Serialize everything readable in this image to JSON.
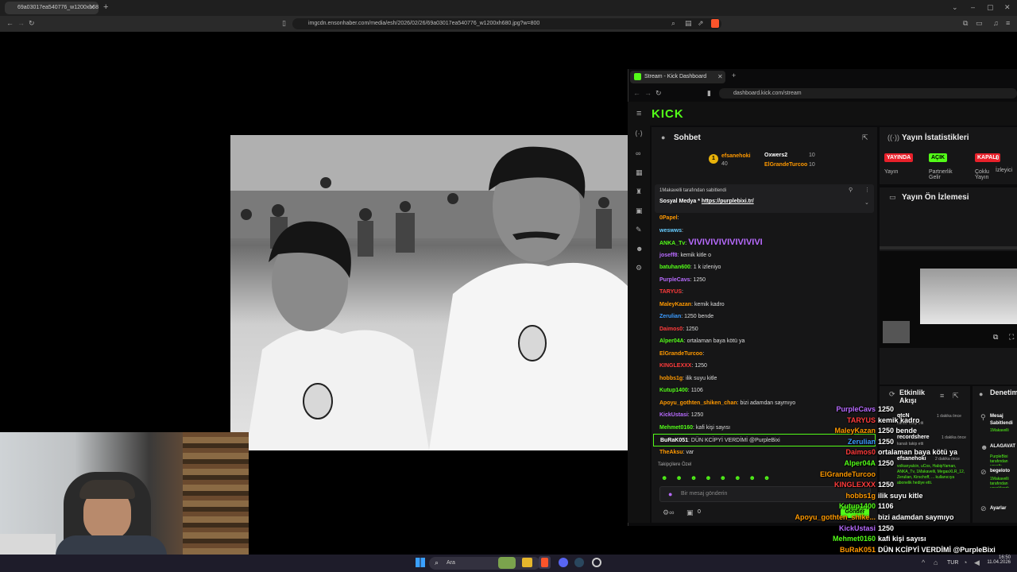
{
  "browser": {
    "tab_title": "69a03017ea540776_w1200xh680",
    "url": "imgcdn.ensonhaber.com/media/esh/2026/02/26/69a03017ea540776_w1200xh680.jpg?w=800"
  },
  "kick_window": {
    "tab_title": "Stream - Kick Dashboard",
    "url": "dashboard.kick.com/stream",
    "logo": "KICK"
  },
  "chat": {
    "title": "Sohbet",
    "top_gifters": [
      {
        "name": "efsanehoki",
        "count": "40"
      },
      {
        "name": "Oxwers2",
        "count": "10"
      },
      {
        "name": "ElGrandeTurcoo",
        "count": "10"
      }
    ],
    "pinned_by": "1Makavelli tarafından sabitlendi",
    "pinned_text": "Sosyal Medya * ",
    "pinned_link": "https://purplebixi.tr/",
    "messages": [
      {
        "user": "0Papel",
        "text": "",
        "color": "#ff9900"
      },
      {
        "user": "weswws",
        "text": "",
        "color": "#66ccff"
      },
      {
        "user": "ANKA_Tv",
        "text": "VIVIVIVIVIVIVIVIVI",
        "color": "#53fc18"
      },
      {
        "user": "joseff8",
        "text": "kemik kitle o",
        "color": "#b86bff"
      },
      {
        "user": "batuhan600",
        "text": "1 k izleniyo",
        "color": "#53fc18"
      },
      {
        "user": "PurpleCavs",
        "text": "1250",
        "color": "#b86bff"
      },
      {
        "user": "TARYUS",
        "text": "",
        "color": "#ff3b3b"
      },
      {
        "user": "MaleyKazan",
        "text": "kemik kadro",
        "color": "#ff9900"
      },
      {
        "user": "Zerulian",
        "text": "1250 bende",
        "color": "#3b9bff"
      },
      {
        "user": "Daimos0",
        "text": "1250",
        "color": "#ff3b3b"
      },
      {
        "user": "Alper04A",
        "text": "ortalaman baya kötü ya",
        "color": "#53fc18"
      },
      {
        "user": "ElGrandeTurcoo",
        "text": "",
        "color": "#ff9900"
      },
      {
        "user": "KINGLEXXX",
        "text": "1250",
        "color": "#ff3b3b"
      },
      {
        "user": "hobbs1g",
        "text": "ilik suyu kitle",
        "color": "#ff9900"
      },
      {
        "user": "Kutup1400",
        "text": "1106",
        "color": "#53fc18"
      },
      {
        "user": "Apoyu_gothten_shiken_chan",
        "text": "bizi adamdan saymıyo",
        "color": "#ff9900"
      },
      {
        "user": "KickUstasi",
        "text": "1250",
        "color": "#b86bff"
      },
      {
        "user": "Mehmet0160",
        "text": "kafi kişi sayısı",
        "color": "#53fc18"
      },
      {
        "user": "BuRaK051",
        "text": "DÜN KCİPYİ VERDİMİ @PurpleBixi",
        "color": "#ffffff"
      },
      {
        "user": "TheAksu",
        "text": "var",
        "color": "#ff9900"
      }
    ],
    "input_placeholder": "Bir mesaj gönderin",
    "send_label": "Gönder",
    "tag": "Takipçilere Özel",
    "counter": "0"
  },
  "stats": {
    "title": "Yayın İstatistikleri",
    "badges": [
      {
        "label": "YAYINDA",
        "caption": "Yayın",
        "color": "#e8202a"
      },
      {
        "label": "AÇIK",
        "caption": "Partnerlik Gelir",
        "color": "#53fc18"
      },
      {
        "label": "KAPALI",
        "caption": "Çoklu Yayın",
        "color": "#e8202a"
      }
    ],
    "viewers_value": "0",
    "viewers_label": "İzleyici"
  },
  "preview": {
    "title": "Yayın Ön İzlemesi"
  },
  "activity": {
    "title": "Etkinlik Akışı",
    "items": [
      {
        "name": "qtcN",
        "time": "1 dakika önce",
        "desc": "kanalı takip etti"
      },
      {
        "name": "recordshere",
        "time": "1 dakika önce",
        "desc": "kanalı takip etti"
      },
      {
        "name": "efsanehoki",
        "time": "2 dakika önce",
        "desc": "volkanyalcin, uCos, HabipYaman, ANKA_Tv, 1Makavelli, MegasXLR_12, Zerulian, Kirschoff, ... kullanıcıya abonelik hediye etti."
      }
    ]
  },
  "events": {
    "title": "Denetim Eylemleri",
    "items": [
      {
        "title": "Mesaj Sabitlendi",
        "sub": "1Makavelli"
      },
      {
        "title": "ALAGAVAT",
        "sub": ""
      },
      {
        "title": "PurpleBixi tarafından yasağı kaldırıldı",
        "sub": ""
      },
      {
        "title": "begeloto",
        "sub": "1Makavelli tarafından yasaklandı"
      },
      {
        "title": "Ayarlar",
        "sub": ""
      }
    ]
  },
  "overlay": [
    {
      "user": "PurpleCavs",
      "text": "1250",
      "color": "#b86bff"
    },
    {
      "user": "TARYUS",
      "text": "kemik kadro",
      "color": "#ff3b3b"
    },
    {
      "user": "MaleyKazan",
      "text": "1250 bende",
      "color": "#ff9900"
    },
    {
      "user": "Zerulian",
      "text": "1250",
      "color": "#3b9bff"
    },
    {
      "user": "Daimos0",
      "text": "ortalaman baya kötü ya",
      "color": "#ff3b3b"
    },
    {
      "user": "Alper04A",
      "text": "1250",
      "color": "#53fc18"
    },
    {
      "user": "ElGrandeTurcoo",
      "text": "",
      "color": "#ff9900"
    },
    {
      "user": "KINGLEXXX",
      "text": "1250",
      "color": "#ff3b3b"
    },
    {
      "user": "hobbs1g",
      "text": "ilik suyu kitle",
      "color": "#ff9900"
    },
    {
      "user": "Kutup1400",
      "text": "1106",
      "color": "#53fc18"
    },
    {
      "user": "Apoyu_gothten_shike...",
      "text": "bizi adamdan saymıyo",
      "color": "#ff9900"
    },
    {
      "user": "KickUstasi",
      "text": "1250",
      "color": "#b86bff"
    },
    {
      "user": "Mehmet0160",
      "text": "kafi kişi sayısı",
      "color": "#53fc18"
    },
    {
      "user": "BuRaK051",
      "text": "DÜN KCİPYİ VERDİMİ @PurpleBixi",
      "color": "#ff9900"
    },
    {
      "user": "TheAksu",
      "text": "",
      "color": "#ff9900"
    }
  ],
  "taskbar": {
    "search_placeholder": "Ara",
    "lang": "TUR",
    "time": "16:50",
    "date": "11.04.2026"
  }
}
